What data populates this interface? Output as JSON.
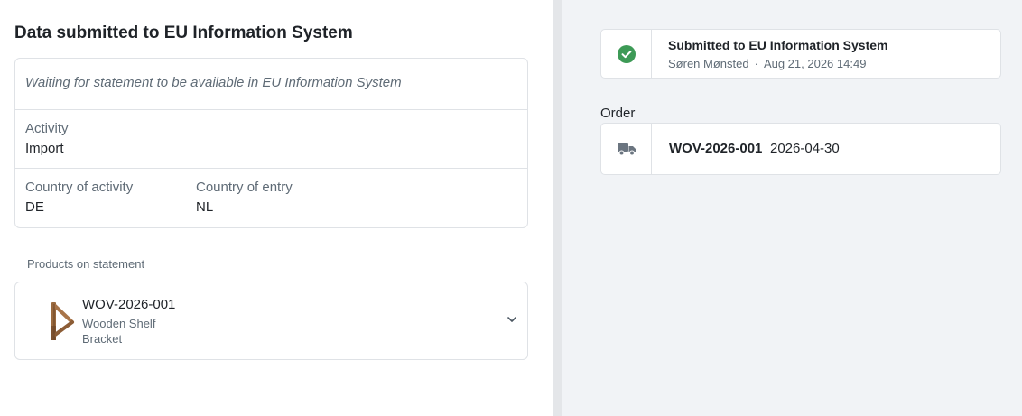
{
  "left": {
    "title": "Data submitted to EU Information System",
    "status_text": "Waiting for statement to be available in EU Information System",
    "activity": {
      "label": "Activity",
      "value": "Import"
    },
    "country_of_activity": {
      "label": "Country of activity",
      "value": "DE"
    },
    "country_of_entry": {
      "label": "Country of entry",
      "value": "NL"
    },
    "products_label": "Products on statement",
    "products": [
      {
        "code": "WOV-2026-001",
        "name": "Wooden Shelf Bracket",
        "icon": "wooden-bracket-image"
      }
    ]
  },
  "right": {
    "event": {
      "title": "Submitted to EU Information System",
      "user": "Søren Mønsted",
      "separator": "·",
      "timestamp": "Aug 21, 2026 14:49",
      "icon": "check-circle-icon",
      "status_color": "#3d9a56"
    },
    "order_label": "Order",
    "order": {
      "code": "WOV-2026-001",
      "date": "2026-04-30",
      "icon": "truck-icon"
    }
  }
}
